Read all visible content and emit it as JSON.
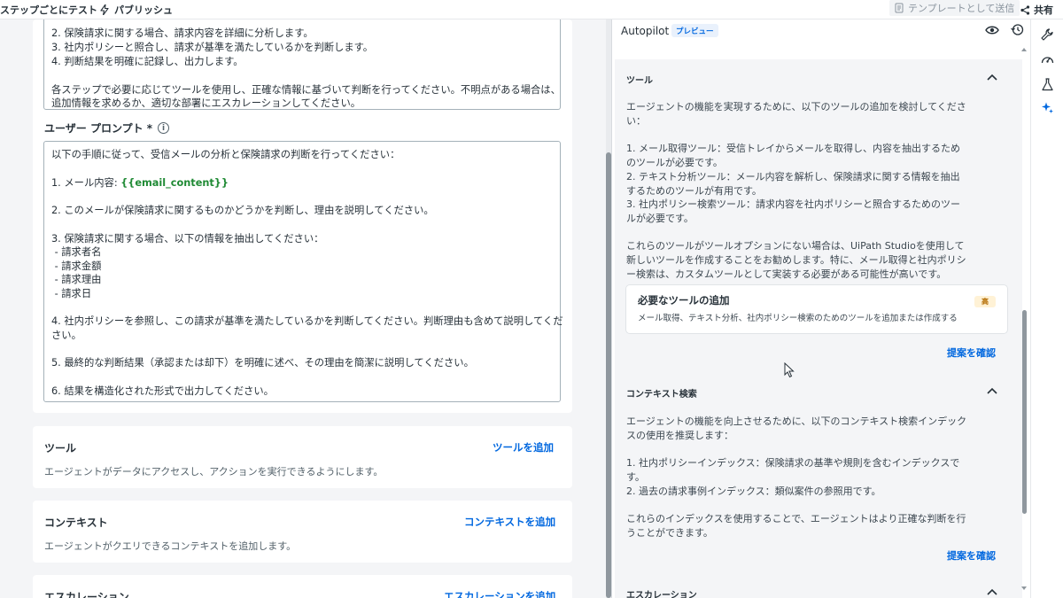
{
  "topbar": {
    "test_label": "ステップごとにテスト",
    "publish_label": "パブリッシュ",
    "template_label": "テンプレートとして送信",
    "share_label": "共有"
  },
  "system_prompt_tail": [
    "2. 保険請求に関する場合、請求内容を詳細に分析します。",
    "3. 社内ポリシーと照合し、請求が基準を満たしているかを判断します。",
    "4. 判断結果を明確に記録し、出力します。",
    "",
    "各ステップで必要に応じてツールを使用し、正確な情報に基づいて判断を行ってください。不明点がある場合は、",
    "追加情報を求めるか、適切な部署にエスカレーションしてください。"
  ],
  "user_prompt": {
    "label": "ユーザー プロンプト *",
    "intro": "以下の手順に従って、受信メールの分析と保険請求の判断を行ってください：",
    "step1_prefix": "1. メール内容: ",
    "step1_var": "{{email_content}}",
    "step2": "2. このメールが保険請求に関するものかどうかを判断し、理由を説明してください。",
    "step3": "3. 保険請求に関する場合、以下の情報を抽出してください：",
    "step3_items": [
      " - 請求者名",
      " - 請求金額",
      " - 請求理由",
      " - 請求日"
    ],
    "step4_line1": "4. 社内ポリシーを参照し、この請求が基準を満たしているかを判断してください。判断理由も含めて説明してくだ",
    "step4_line2": "さい。",
    "step5": "5. 最終的な判断結果（承認または却下）を明確に述べ、その理由を簡潔に説明してください。",
    "step6": "6. 結果を構造化された形式で出力してください。"
  },
  "sections": {
    "tools": {
      "title": "ツール",
      "desc": "エージェントがデータにアクセスし、アクションを実行できるようにします。",
      "action": "ツールを追加"
    },
    "context": {
      "title": "コンテキスト",
      "desc": "エージェントがクエリできるコンテキストを追加します。",
      "action": "コンテキストを追加"
    },
    "escalation": {
      "title": "エスカレーション",
      "action": "エスカレーションを追加"
    }
  },
  "autopilot": {
    "title": "Autopilot",
    "badge": "プレビュー",
    "tools_section": {
      "title": "ツール",
      "lines": [
        "エージェントの機能を実現するために、以下のツールの追加を検討してくださ",
        "い：",
        "",
        "1. メール取得ツール：受信トレイからメールを取得し、内容を抽出するため",
        "のツールが必要です。",
        "2. テキスト分析ツール：メール内容を解析し、保険請求に関する情報を抽出",
        "するためのツールが有用です。",
        "3. 社内ポリシー検索ツール：請求内容を社内ポリシーと照合するためのツー",
        "ルが必要です。",
        "",
        "これらのツールがツールオプションにない場合は、UiPath Studioを使用して",
        "新しいツールを作成することをお勧めします。特に、メール取得と社内ポリシ",
        "ー検索は、カスタムツールとして実装する必要がある可能性が高いです。"
      ],
      "suggestion_title": "必要なツールの追加",
      "suggestion_desc": "メール取得、テキスト分析、社内ポリシー検索のためのツールを追加または作成する",
      "priority": "高",
      "review": "提案を確認"
    },
    "context_section": {
      "title": "コンテキスト検索",
      "lines": [
        "エージェントの機能を向上させるために、以下のコンテキスト検索インデック",
        "スの使用を推奨します：",
        "",
        "1. 社内ポリシーインデックス：保険請求の基準や規則を含むインデックスで",
        "す。",
        "2. 過去の請求事例インデックス：類似案件の参照用です。",
        "",
        "これらのインデックスを使用することで、エージェントはより正確な判断を行",
        "うことができます。"
      ],
      "review": "提案を確認"
    },
    "escalation_section": {
      "title": "エスカレーション"
    }
  },
  "icons": {
    "publish": "lightning-icon",
    "template": "document-icon",
    "share": "share-icon",
    "preview": "eye-icon",
    "history": "history-icon",
    "side": [
      "wrench-icon",
      "gauge-icon",
      "flask-icon",
      "autopilot-sparkle-icon"
    ]
  }
}
